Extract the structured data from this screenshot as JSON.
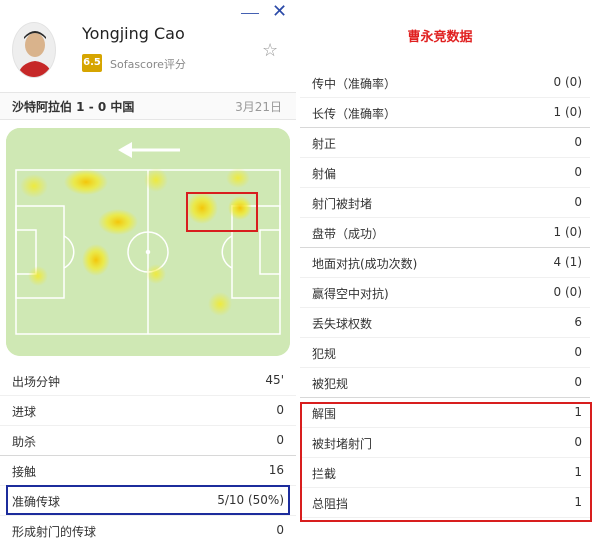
{
  "window": {
    "minimize_glyph": "—",
    "close_glyph": "✕"
  },
  "player": {
    "name": "Yongjing Cao",
    "rating": "6.5",
    "rating_source": "Sofascore评分",
    "favorite_icon": "star-outline-icon"
  },
  "match": {
    "title": "沙特阿拉伯 1 - 0 中国",
    "date": "3月21日"
  },
  "heatmap": {
    "direction_icon": "arrow-left-icon"
  },
  "left_stats": [
    {
      "label": "出场分钟",
      "value": "45'"
    },
    {
      "label": "进球",
      "value": "0"
    },
    {
      "label": "助杀",
      "value": "0"
    },
    {
      "label": "接触",
      "value": "16"
    },
    {
      "label": "准确传球",
      "value": "5/10 (50%)"
    },
    {
      "label": "形成射门的传球",
      "value": "0"
    }
  ],
  "right_panel": {
    "title": "曹永竞数据",
    "stats": [
      {
        "label": "传中（准确率）",
        "value": "0 (0)"
      },
      {
        "label": "长传（准确率）",
        "value": "1 (0)"
      },
      {
        "label": "射正",
        "value": "0"
      },
      {
        "label": "射偏",
        "value": "0"
      },
      {
        "label": "射门被封堵",
        "value": "0"
      },
      {
        "label": "盘带（成功）",
        "value": "1 (0)"
      },
      {
        "label": "地面对抗(成功次数)",
        "value": "4 (1)"
      },
      {
        "label": "赢得空中对抗)",
        "value": "0 (0)"
      },
      {
        "label": "丢失球权数",
        "value": "6"
      },
      {
        "label": "犯规",
        "value": "0"
      },
      {
        "label": "被犯规",
        "value": "0"
      },
      {
        "label": "解围",
        "value": "1"
      },
      {
        "label": "被封堵射门",
        "value": "0"
      },
      {
        "label": "拦截",
        "value": "1"
      },
      {
        "label": "总阻挡",
        "value": "1"
      }
    ]
  },
  "colors": {
    "accent_red": "#e02020",
    "highlight_red": "#d81e1e",
    "highlight_blue": "#1c2c9c",
    "rating_badge": "#d6a500",
    "pitch": "#cfe8b4"
  }
}
